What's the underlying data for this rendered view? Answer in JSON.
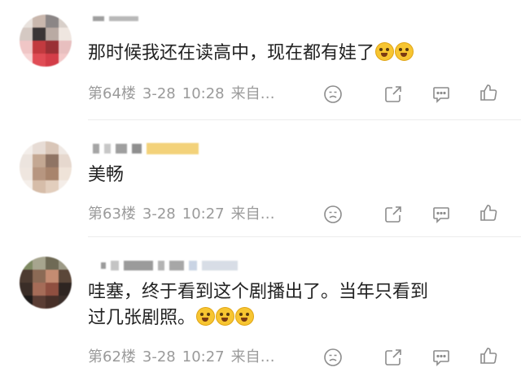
{
  "comments": [
    {
      "text": "那时候我还在读高中，现在都有娃了",
      "emoji_count": 2,
      "floor": "第64楼",
      "date": "3-28",
      "time": "10:28",
      "source": "来自…"
    },
    {
      "text": "美畅",
      "floor": "第63楼",
      "date": "3-28",
      "time": "10:27",
      "source": "来自…"
    },
    {
      "text_line1": "哇塞，终于看到这个剧播出了。当年只看到",
      "text_line2": "过几张剧照。",
      "emoji_count": 3,
      "floor": "第62楼",
      "date": "3-28",
      "time": "10:27",
      "source": "来自…"
    }
  ],
  "icons": [
    "emoji-reaction-icon",
    "share-icon",
    "comment-icon",
    "like-icon"
  ],
  "colors": {
    "meta": "#9a9a9a",
    "icon": "#8c8c8c",
    "divider": "#ececec",
    "emoji": "#f7c531"
  }
}
